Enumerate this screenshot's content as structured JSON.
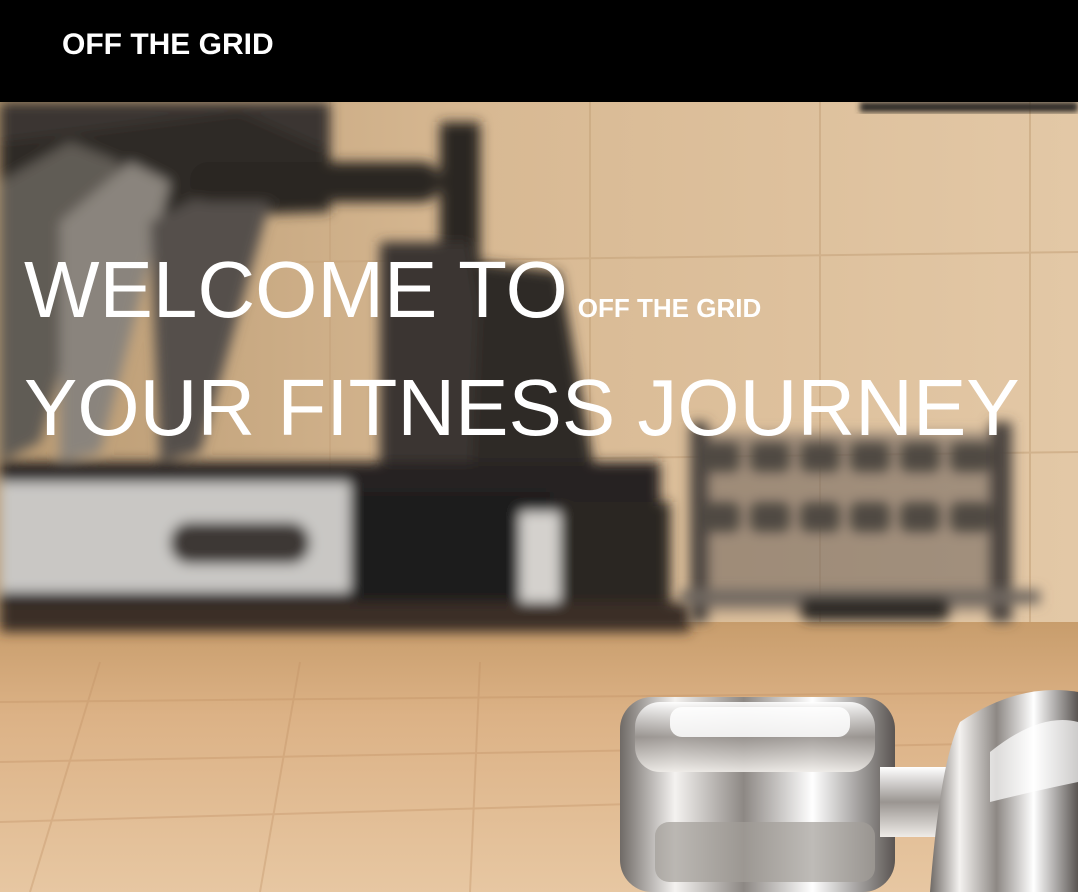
{
  "navbar": {
    "brand": "OFF THE GRID"
  },
  "hero": {
    "headline_part1": "WELCOME TO",
    "headline_brand": "OFF THE GRID",
    "headline_line2": "YOUR FITNESS JOURNEY",
    "background_image": "gym-interior-photo"
  },
  "colors": {
    "navbar_bg": "#000000",
    "text": "#ffffff",
    "floor": "#d9b287",
    "wall": "#d8b68f"
  }
}
